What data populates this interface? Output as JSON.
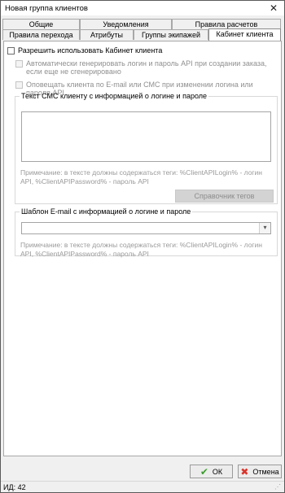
{
  "window": {
    "title": "Новая группа клиентов",
    "close_symbol": "✕"
  },
  "tabs": {
    "row1": [
      "Общие",
      "Уведомления",
      "Правила расчетов"
    ],
    "row2": [
      "Правила перехода",
      "Атрибуты",
      "Группы экипажей",
      "Кабинет клиента"
    ],
    "active": "Кабинет клиента"
  },
  "content": {
    "allow_cabinet": {
      "label": "Разрешить использовать Кабинет клиента",
      "checked": false
    },
    "auto_generate": {
      "label": "Автоматически генерировать логин и пароль API при создании заказа, если еще не сгенерировано",
      "checked": false,
      "disabled": true
    },
    "notify_client": {
      "label": "Оповещать клиента по E-mail или СМС при изменении логина или пароля API",
      "checked": false,
      "disabled": true
    },
    "sms_group": {
      "legend": "Текст СМС клиенту с информацией о логине и пароле",
      "text": "",
      "note": "Примечание: в тексте должны содержаться теги: %ClientAPILogin% - логин API, %ClientAPIPassword% - пароль API",
      "tags_button": "Справочник тегов"
    },
    "email_group": {
      "legend": "Шаблон E-mail с информацией о логине и пароле",
      "selected": "",
      "note": "Примечание: в тексте должны содержаться теги: %ClientAPILogin% - логин API, %ClientAPIPassword% - пароль API"
    }
  },
  "footer": {
    "ok": {
      "label": "ОК",
      "icon": "check-icon",
      "color": "#3b9c2e"
    },
    "cancel": {
      "label": "Отмена",
      "icon": "cross-icon",
      "color": "#d9342b"
    }
  },
  "status": {
    "text": "ИД: 42"
  }
}
